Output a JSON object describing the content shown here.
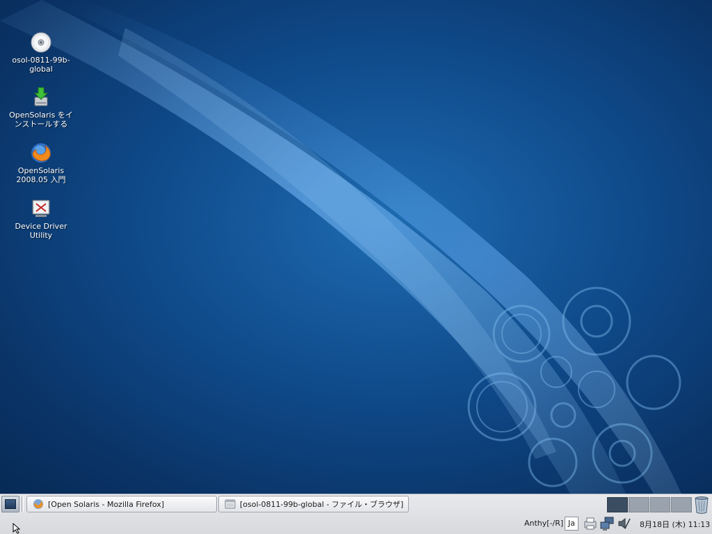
{
  "desktop_icons": [
    {
      "label": "osol-0811-99b-\nglobal",
      "icon": "cd-disc-icon"
    },
    {
      "label": "OpenSolaris をイ\nンストールする",
      "icon": "install-icon"
    },
    {
      "label": "OpenSolaris\n2008.05 入門",
      "icon": "firefox-icon"
    },
    {
      "label": "Device Driver\nUtility",
      "icon": "device-driver-utility-icon"
    }
  ],
  "taskbar": {
    "tasks": [
      {
        "label": "[Open Solaris - Mozilla Firefox]",
        "icon": "firefox-icon"
      },
      {
        "label": "[osol-0811-99b-global - ファイル・ブラウザ]",
        "icon": "file-browser-icon"
      }
    ],
    "workspaces": 4,
    "active_workspace": 1
  },
  "tray": {
    "ime": "Anthy[-/R]",
    "lang": "Ja",
    "clock": "8月18日 (木) 11:13"
  },
  "colors": {
    "wallpaper": "#0f4a8a",
    "panel": "#e0e2e6",
    "active_workspace": "#3b4d60"
  }
}
